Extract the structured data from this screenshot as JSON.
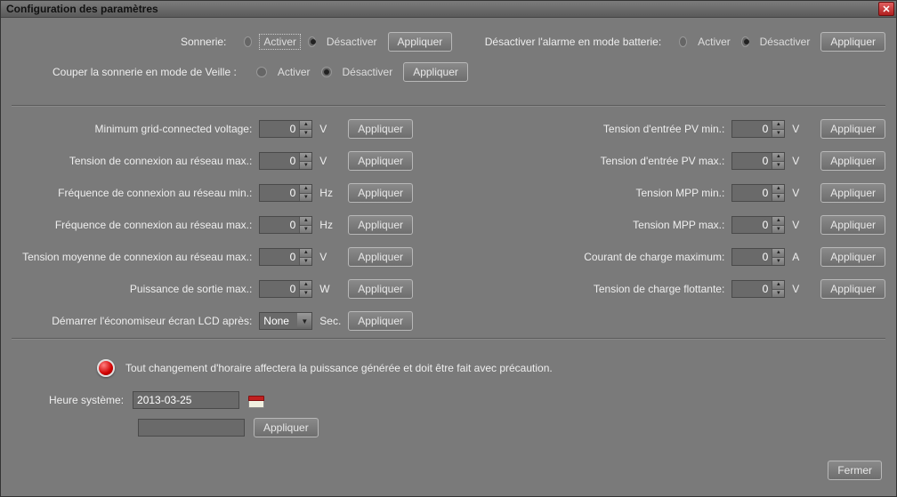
{
  "window": {
    "title": "Configuration des paramètres"
  },
  "labels": {
    "sonnerie": "Sonnerie:",
    "activer": "Activer",
    "desactiver": "Désactiver",
    "appliquer": "Appliquer",
    "alarme_batterie": "Désactiver l'alarme en mode batterie:",
    "couper_sonnerie": "Couper la sonnerie en mode de Veille :",
    "fermer": "Fermer"
  },
  "params_left": [
    {
      "label": "Minimum grid-connected voltage:",
      "value": "0",
      "unit": "V"
    },
    {
      "label": "Tension de connexion au réseau max.:",
      "value": "0",
      "unit": "V"
    },
    {
      "label": "Fréquence de connexion au réseau min.:",
      "value": "0",
      "unit": "Hz"
    },
    {
      "label": "Fréquence de connexion au réseau max.:",
      "value": "0",
      "unit": "Hz"
    },
    {
      "label": "Tension moyenne de connexion au réseau max.:",
      "value": "0",
      "unit": "V"
    },
    {
      "label": "Puissance de sortie max.:",
      "value": "0",
      "unit": "W"
    }
  ],
  "lcd": {
    "label": "Démarrer l'économiseur écran LCD après:",
    "value": "None",
    "unit": "Sec."
  },
  "params_right": [
    {
      "label": "Tension d'entrée PV min.:",
      "value": "0",
      "unit": "V"
    },
    {
      "label": "Tension d'entrée PV max.:",
      "value": "0",
      "unit": "V"
    },
    {
      "label": "Tension MPP min.:",
      "value": "0",
      "unit": "V"
    },
    {
      "label": "Tension MPP max.:",
      "value": "0",
      "unit": "V"
    },
    {
      "label": "Courant de charge maximum:",
      "value": "0",
      "unit": "A"
    },
    {
      "label": "Tension de charge flottante:",
      "value": "0",
      "unit": "V"
    }
  ],
  "warning": "Tout changement d'horaire affectera la puissance générée et doit être fait avec précaution.",
  "system_time": {
    "label": "Heure système:",
    "date": "2013-03-25",
    "time": ""
  }
}
